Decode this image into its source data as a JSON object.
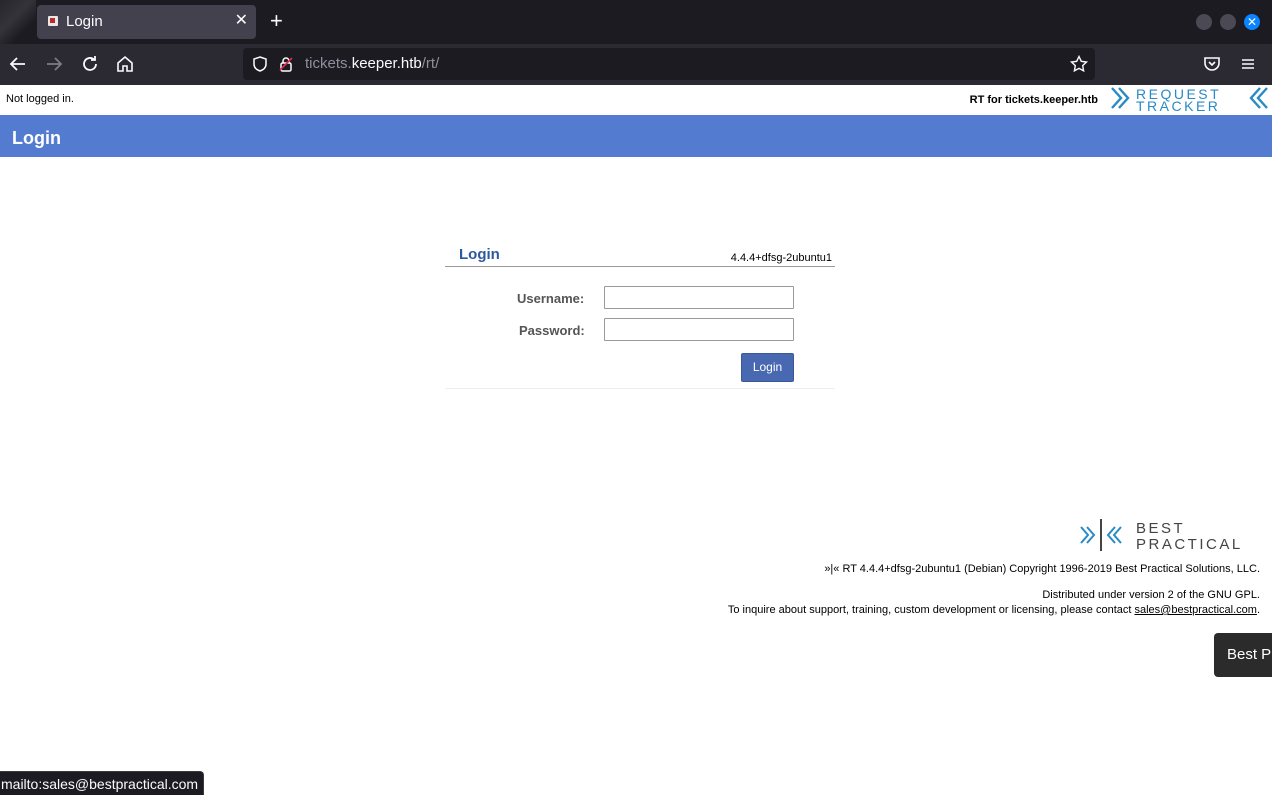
{
  "browser": {
    "tab_title": "Login",
    "tab_close": "✕",
    "new_tab": "+",
    "url_host_prefix": "tickets.",
    "url_host": "keeper.htb",
    "url_path": "/rt/",
    "close_symbol": "✕"
  },
  "header": {
    "login_status": "Not logged in.",
    "rt_for": "RT for tickets.keeper.htb",
    "logo_line1": "REQUEST",
    "logo_line2": "TRACKER"
  },
  "title": "Login",
  "login": {
    "heading": "Login",
    "version": "4.4.4+dfsg-2ubuntu1",
    "username_label": "Username:",
    "password_label": "Password:",
    "username_value": "",
    "password_value": "",
    "submit_label": "Login"
  },
  "footer": {
    "bp_logo_line1": "BEST",
    "bp_logo_line2": "PRACTICAL",
    "copyright": "»|« RT 4.4.4+dfsg-2ubuntu1 (Debian) Copyright 1996-2019 Best Practical Solutions, LLC.",
    "license": "Distributed under version 2 of the GNU GPL.",
    "contact_prefix": "To inquire about support, training, custom development or licensing, please contact ",
    "contact_email": "sales@bestpractical.com",
    "contact_suffix": "."
  },
  "tooltip": "Best Pr",
  "status_url": "mailto:sales@bestpractical.com",
  "colors": {
    "title_bar": "#537bcf",
    "login_button": "#4868b2",
    "logo_blue": "#2a8ac4"
  }
}
